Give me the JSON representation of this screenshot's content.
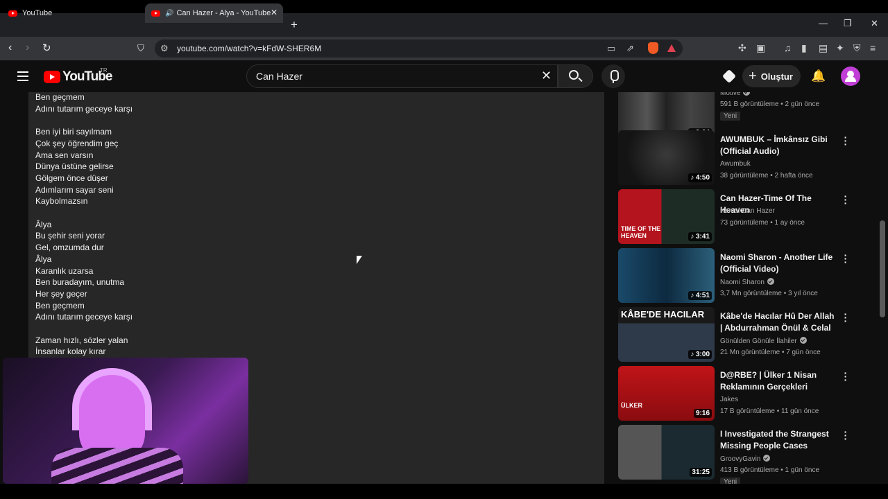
{
  "browser": {
    "tabs": [
      {
        "title": "YouTube"
      },
      {
        "title": "Can Hazer - Alya - YouTube"
      }
    ],
    "url": "youtube.com/watch?v=kFdW-SHER6M"
  },
  "youtube": {
    "logo_text": "YouTube",
    "region": "TR",
    "search_value": "Can Hazer",
    "create_label": "Oluştur"
  },
  "lyrics": [
    "Ben geçmem",
    "Adını tutarım geceye karşı",
    "",
    "Ben iyi biri sayılmam",
    "Çok şey öğrendim geç",
    "Ama sen varsın",
    "Dünya üstüne gelirse",
    "Gölgem önce düşer",
    "Adımlarım sayar seni",
    "Kaybolmazsın",
    "",
    "Âlya",
    "Bu şehir seni yorar",
    "Gel, omzumda dur",
    "Âlya",
    "Karanlık uzarsa",
    "Ben buradayım, unutma",
    "Her şey geçer",
    "Ben geçmem",
    "Adını tutarım geceye karşı",
    "",
    "Zaman hızlı, sözler yalan",
    "İnsanlar kolay kırar"
  ],
  "recommended": [
    {
      "title": "",
      "channel": "Motive",
      "verified": true,
      "meta": "591 B görüntüleme • 2 gün önce",
      "badge": "Yeni",
      "duration": "3:04",
      "music": true
    },
    {
      "title": "AWUMBUK – İmkânsız Gibi (Official Audio)",
      "channel": "Awumbuk",
      "verified": false,
      "meta": "38 görüntüleme • 2 hafta önce",
      "badge": "",
      "duration": "4:50",
      "music": true
    },
    {
      "title": "Can Hazer-Time Of The Heaven",
      "channel": "Kemal Can Hazer",
      "verified": false,
      "meta": "73 görüntüleme • 1 ay önce",
      "badge": "",
      "duration": "3:41",
      "music": true,
      "thumb_text": "TIME OF THE HEAVEN"
    },
    {
      "title": "Naomi Sharon - Another Life (Official Video)",
      "channel": "Naomi Sharon",
      "verified": true,
      "meta": "3,7 Mn görüntüleme • 3 yıl önce",
      "badge": "",
      "duration": "4:51",
      "music": true
    },
    {
      "title": "Kâbe'de Hacılar Hû Der Allah | Abdurrahman Önül & Celal ...",
      "channel": "Gönülden Gönüle İlahiler",
      "verified": true,
      "meta": "21 Mn görüntüleme • 7 gün önce",
      "badge": "",
      "duration": "3:00",
      "music": true,
      "thumb_text": "KÂBE'DE HACILAR"
    },
    {
      "title": "D@RBE? | Ülker 1 Nisan Reklamının Gerçekleri",
      "channel": "Jakes",
      "verified": false,
      "meta": "17 B görüntüleme • 11 gün önce",
      "badge": "",
      "duration": "9:16",
      "music": false,
      "thumb_text": "ÜLKER"
    },
    {
      "title": "I Investigated the Strangest Missing People Cases (Missin...",
      "channel": "GroovyGavin",
      "verified": true,
      "meta": "413 B görüntüleme • 1 gün önce",
      "badge": "Yeni",
      "duration": "31:25",
      "music": false
    }
  ]
}
